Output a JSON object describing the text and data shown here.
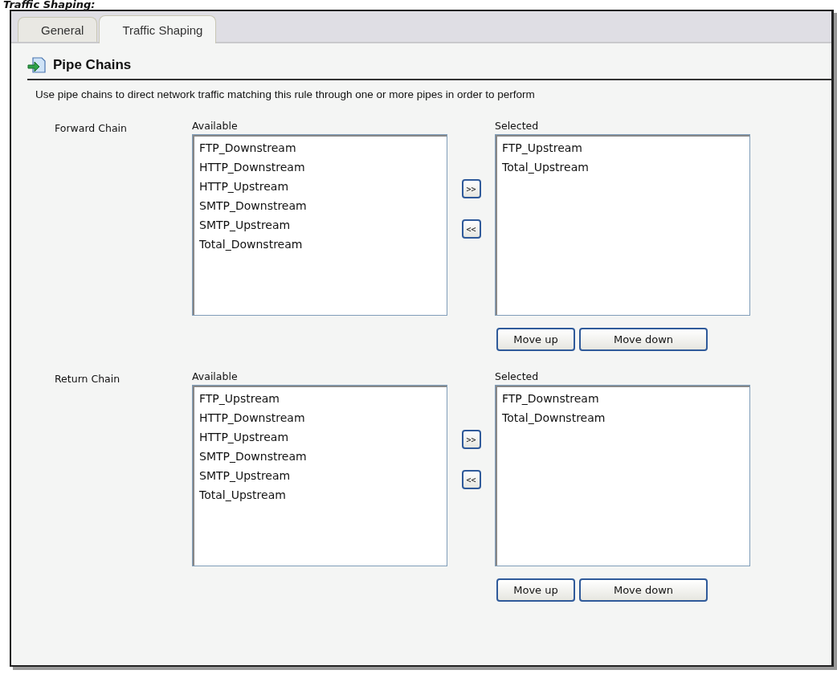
{
  "caption": "Traffic Shaping:",
  "tabs": [
    {
      "label": "General",
      "selected": false
    },
    {
      "label": "Traffic Shaping",
      "selected": true
    }
  ],
  "section": {
    "title": "Pipe Chains",
    "description": "Use pipe chains to direct network traffic matching this rule through one or more pipes in order to perform"
  },
  "chains": [
    {
      "label": "Forward Chain",
      "available_label": "Available",
      "available": [
        "FTP_Downstream",
        "HTTP_Downstream",
        "HTTP_Upstream",
        "SMTP_Downstream",
        "SMTP_Upstream",
        "Total_Downstream"
      ],
      "add_button": ">>",
      "remove_button": "<<",
      "selected_label": "Selected",
      "selected": [
        "FTP_Upstream",
        "Total_Upstream"
      ],
      "move_up": "Move up",
      "move_down": "Move down"
    },
    {
      "label": "Return Chain",
      "available_label": "Available",
      "available": [
        "FTP_Upstream",
        "HTTP_Downstream",
        "HTTP_Upstream",
        "SMTP_Downstream",
        "SMTP_Upstream",
        "Total_Upstream"
      ],
      "add_button": ">>",
      "remove_button": "<<",
      "selected_label": "Selected",
      "selected": [
        "FTP_Downstream",
        "Total_Downstream"
      ],
      "move_up": "Move up",
      "move_down": "Move down"
    }
  ]
}
